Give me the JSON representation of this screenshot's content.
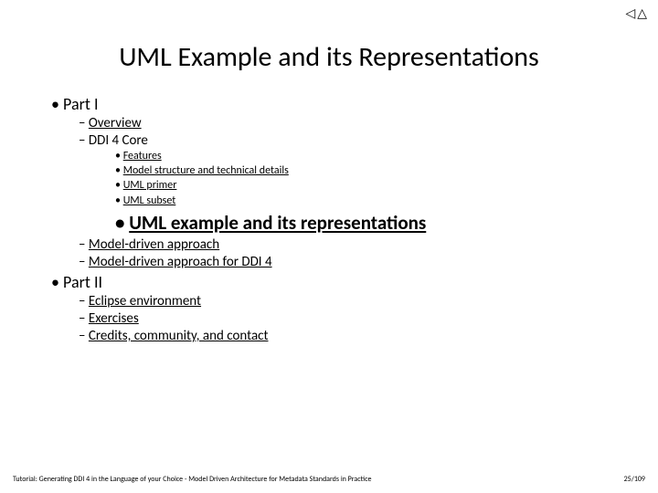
{
  "nav": {
    "prev_glyph": "◁",
    "next_glyph": "△"
  },
  "title": "UML Example and its Representations",
  "outline": {
    "part1": {
      "label": "Part I",
      "items": {
        "overview": "Overview",
        "ddi4core": "DDI 4 Core",
        "ddi4core_sub": {
          "features": "Features",
          "model_struct": "Model structure and technical details",
          "uml_primer": "UML primer",
          "uml_subset": "UML subset",
          "current": "UML example and its representations"
        },
        "mda": "Model-driven approach",
        "mda_ddi4": "Model-driven approach for DDI 4"
      }
    },
    "part2": {
      "label": "Part II",
      "items": {
        "eclipse": "Eclipse environment",
        "exercises": "Exercises",
        "credits": "Credits, community, and contact"
      }
    }
  },
  "footer": {
    "text": "Tutorial: Generating DDI 4 in the Language of your Choice -  Model Driven Architecture for Metadata Standards in Practice",
    "page": "25/109"
  }
}
